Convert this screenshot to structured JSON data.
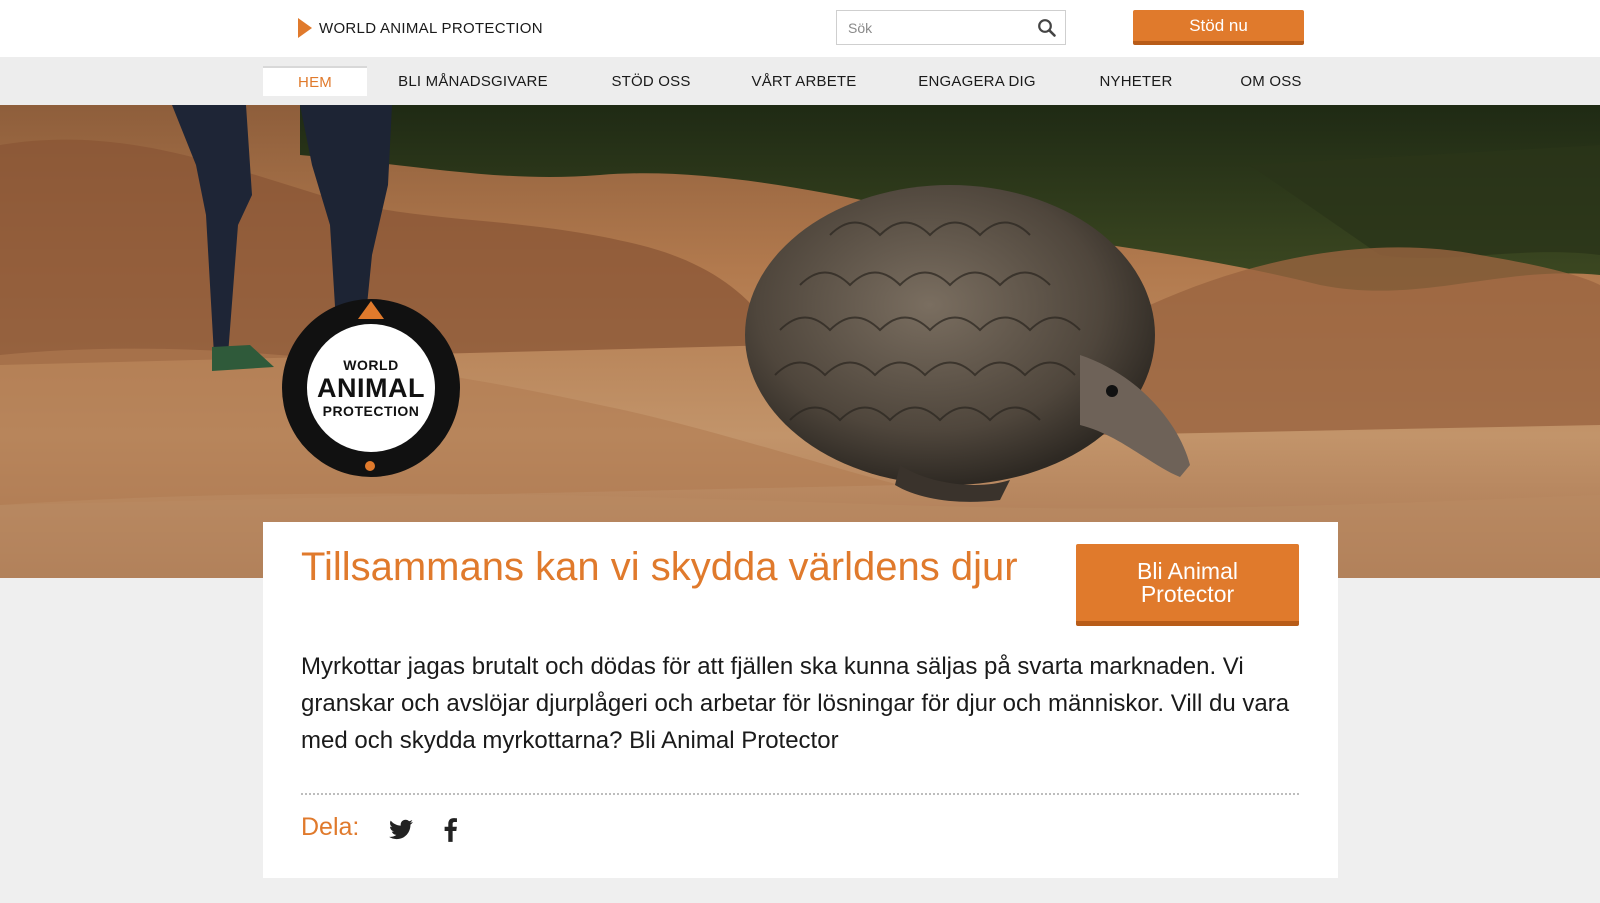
{
  "header": {
    "brand_name": "WORLD ANIMAL PROTECTION",
    "search_placeholder": "Sök",
    "support_button": "Stöd nu"
  },
  "nav": {
    "items": [
      {
        "label": "HEM",
        "active": true
      },
      {
        "label": "BLI MÅNADSGIVARE"
      },
      {
        "label": "STÖD OSS"
      },
      {
        "label": "VÅRT ARBETE"
      },
      {
        "label": "ENGAGERA DIG"
      },
      {
        "label": "NYHETER"
      },
      {
        "label": "OM OSS"
      }
    ]
  },
  "hero": {
    "logo": {
      "line1": "WORLD",
      "line2": "ANIMAL",
      "line3": "PROTECTION"
    }
  },
  "card": {
    "headline": "Tillsammans kan vi skydda världens djur",
    "cta": "Bli Animal Protector",
    "body": "Myrkottar jagas brutalt och dödas för att fjällen ska kunna säljas på svarta marknaden. Vi granskar och avslöjar djurplågeri och arbetar för lösningar för djur och människor. Vill du vara med och skydda myrkottarna? Bli Animal Protector",
    "share_label": "Dela:"
  },
  "icons": {
    "search": "search-icon",
    "share": [
      "twitter-icon",
      "facebook-icon"
    ]
  },
  "colors": {
    "accent": "#e07a2c",
    "accent_dark": "#b85c18",
    "nav_bg": "#ededed",
    "page_bg": "#efefef"
  }
}
